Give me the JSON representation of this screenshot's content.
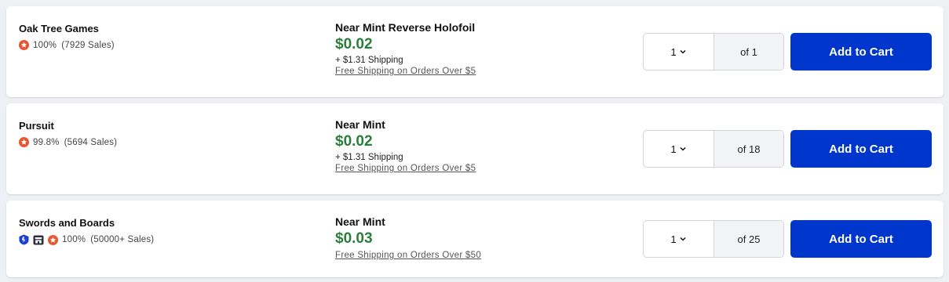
{
  "listings": [
    {
      "seller": "Oak Tree Games",
      "badges": [
        "gold-star-icon"
      ],
      "rating": "100%",
      "sales": "(7929 Sales)",
      "condition": "Near Mint Reverse Holofoil",
      "price": "$0.02",
      "shipping": "+  $1.31 Shipping",
      "free_shipping": "Free Shipping on Orders Over $5",
      "qty": "1",
      "available": "of 1",
      "button": "Add to Cart"
    },
    {
      "seller": "Pursuit",
      "badges": [
        "gold-star-icon"
      ],
      "rating": "99.8%",
      "sales": "(5694 Sales)",
      "condition": "Near Mint",
      "price": "$0.02",
      "shipping": "+  $1.31 Shipping",
      "free_shipping": "Free Shipping on Orders Over $5",
      "qty": "1",
      "available": "of 18",
      "button": "Add to Cart"
    },
    {
      "seller": "Swords and Boards",
      "badges": [
        "direct-icon",
        "store-icon",
        "gold-star-icon"
      ],
      "rating": "100%",
      "sales": "(50000+ Sales)",
      "condition": "Near Mint",
      "price": "$0.03",
      "shipping": "",
      "free_shipping": "Free Shipping on Orders Over $50",
      "qty": "1",
      "available": "of 25",
      "button": "Add to Cart"
    }
  ],
  "colors": {
    "price": "#2a7d3a",
    "button": "#0036cc",
    "star_badge": "#e8552f",
    "direct_badge": "#1a3fd6"
  }
}
